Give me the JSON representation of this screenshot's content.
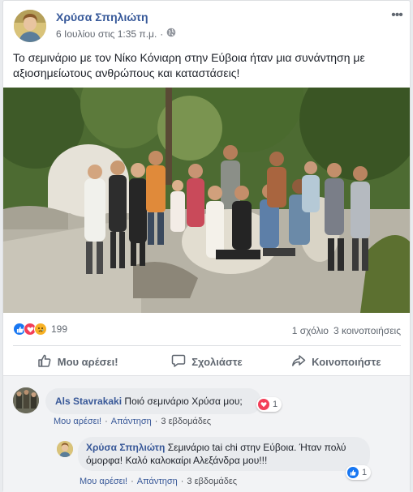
{
  "post": {
    "author": "Χρύσα Σπηλιώτη",
    "date": "6 Ιουλίου στις 1:35 π.μ.",
    "audience_icon": "globe-icon",
    "menu_icon": "more-options-icon",
    "text": "Το σεμινάριο με τον Νίκο Κόνιαρη στην Εύβοια ήταν μια συνάντηση με αξιοσημείωτους ανθρώπους και καταστάσεις!"
  },
  "stats": {
    "reactions": [
      "like",
      "love",
      "sad"
    ],
    "reaction_count": "199",
    "comments": "1 σχόλιο",
    "shares": "3 κοινοποιήσεις"
  },
  "actions": {
    "like": "Μου αρέσει!",
    "comment": "Σχολιάστε",
    "share": "Κοινοποιήστε"
  },
  "comments": [
    {
      "author": "Als Stavrakaki",
      "text": "Ποιό σεμινάριο Χρύσα μου;",
      "reaction_type": "love",
      "reaction_count": "1",
      "like_link": "Μου αρέσει!",
      "reply_link": "Απάντηση",
      "time": "3 εβδομάδες"
    },
    {
      "author": "Χρύσα Σπηλιώτη",
      "text": "Σεμινάριο tai chi στην Εύβοια. Ήταν πολύ όμορφα! Καλό καλοκαίρι Αλεξάνδρα μου!!!",
      "reaction_type": "like",
      "reaction_count": "1",
      "like_link": "Μου αρέσει!",
      "reply_link": "Απάντηση",
      "time": "3 εβδομάδες"
    }
  ],
  "colors": {
    "link": "#365899",
    "like_blue": "#1877f2",
    "love_red": "#f33e58",
    "sad_yellow": "#f7b125",
    "muted": "#606770"
  }
}
